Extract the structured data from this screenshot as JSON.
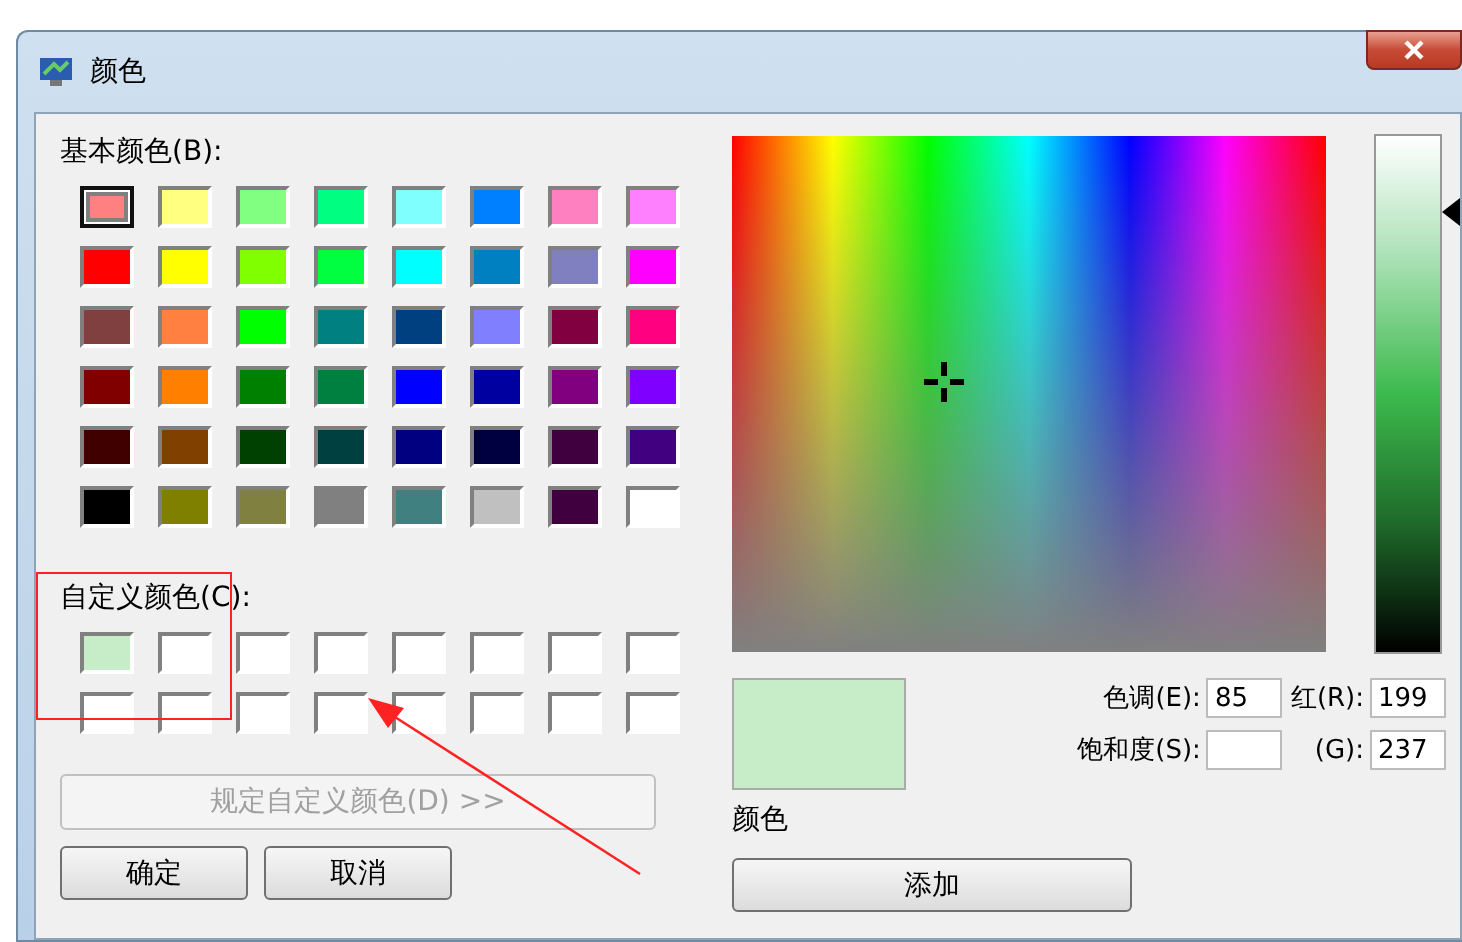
{
  "window": {
    "title": "颜色"
  },
  "basic_colors": {
    "label": "基本颜色(B):",
    "swatches": [
      {
        "color": "#ff8080",
        "selected": true
      },
      {
        "color": "#ffff80",
        "selected": false
      },
      {
        "color": "#80ff80",
        "selected": false
      },
      {
        "color": "#00ff80",
        "selected": false
      },
      {
        "color": "#80ffff",
        "selected": false
      },
      {
        "color": "#0080ff",
        "selected": false
      },
      {
        "color": "#ff80c0",
        "selected": false
      },
      {
        "color": "#ff80ff",
        "selected": false
      },
      {
        "color": "#ff0000",
        "selected": false
      },
      {
        "color": "#ffff00",
        "selected": false
      },
      {
        "color": "#80ff00",
        "selected": false
      },
      {
        "color": "#00ff40",
        "selected": false
      },
      {
        "color": "#00ffff",
        "selected": false
      },
      {
        "color": "#0080c0",
        "selected": false
      },
      {
        "color": "#8080c0",
        "selected": false
      },
      {
        "color": "#ff00ff",
        "selected": false
      },
      {
        "color": "#804040",
        "selected": false
      },
      {
        "color": "#ff8040",
        "selected": false
      },
      {
        "color": "#00ff00",
        "selected": false
      },
      {
        "color": "#008080",
        "selected": false
      },
      {
        "color": "#004080",
        "selected": false
      },
      {
        "color": "#8080ff",
        "selected": false
      },
      {
        "color": "#800040",
        "selected": false
      },
      {
        "color": "#ff0080",
        "selected": false
      },
      {
        "color": "#800000",
        "selected": false
      },
      {
        "color": "#ff8000",
        "selected": false
      },
      {
        "color": "#008000",
        "selected": false
      },
      {
        "color": "#008040",
        "selected": false
      },
      {
        "color": "#0000ff",
        "selected": false
      },
      {
        "color": "#0000a0",
        "selected": false
      },
      {
        "color": "#800080",
        "selected": false
      },
      {
        "color": "#8000ff",
        "selected": false
      },
      {
        "color": "#400000",
        "selected": false
      },
      {
        "color": "#804000",
        "selected": false
      },
      {
        "color": "#004000",
        "selected": false
      },
      {
        "color": "#004040",
        "selected": false
      },
      {
        "color": "#000080",
        "selected": false
      },
      {
        "color": "#000040",
        "selected": false
      },
      {
        "color": "#400040",
        "selected": false
      },
      {
        "color": "#400080",
        "selected": false
      },
      {
        "color": "#000000",
        "selected": false
      },
      {
        "color": "#808000",
        "selected": false
      },
      {
        "color": "#808040",
        "selected": false
      },
      {
        "color": "#808080",
        "selected": false
      },
      {
        "color": "#408080",
        "selected": false
      },
      {
        "color": "#c0c0c0",
        "selected": false
      },
      {
        "color": "#400040",
        "selected": false
      },
      {
        "color": "#ffffff",
        "selected": false
      }
    ]
  },
  "custom_colors": {
    "label": "自定义颜色(C):",
    "swatches": [
      {
        "color": "#c6ecc8"
      },
      {
        "color": "#ffffff"
      },
      {
        "color": "#ffffff"
      },
      {
        "color": "#ffffff"
      },
      {
        "color": "#ffffff"
      },
      {
        "color": "#ffffff"
      },
      {
        "color": "#ffffff"
      },
      {
        "color": "#ffffff"
      },
      {
        "color": "#ffffff"
      },
      {
        "color": "#ffffff"
      },
      {
        "color": "#ffffff"
      },
      {
        "color": "#ffffff"
      },
      {
        "color": "#ffffff"
      },
      {
        "color": "#ffffff"
      },
      {
        "color": "#ffffff"
      },
      {
        "color": "#ffffff"
      }
    ]
  },
  "define_button": {
    "label": "规定自定义颜色(D) >>",
    "disabled": true
  },
  "ok_button": "确定",
  "cancel_button": "取消",
  "luminance_slider": {
    "level": 0.85
  },
  "preview": {
    "color": "#c6ecc8",
    "label": "颜色"
  },
  "fields": [
    {
      "label": "色调(E):",
      "value": "85"
    },
    {
      "label": "红(R):",
      "value": "199"
    },
    {
      "label": "饱和度(S):"
    },
    {
      "label": "(G):",
      "value": "237"
    }
  ],
  "add_button": "添加"
}
